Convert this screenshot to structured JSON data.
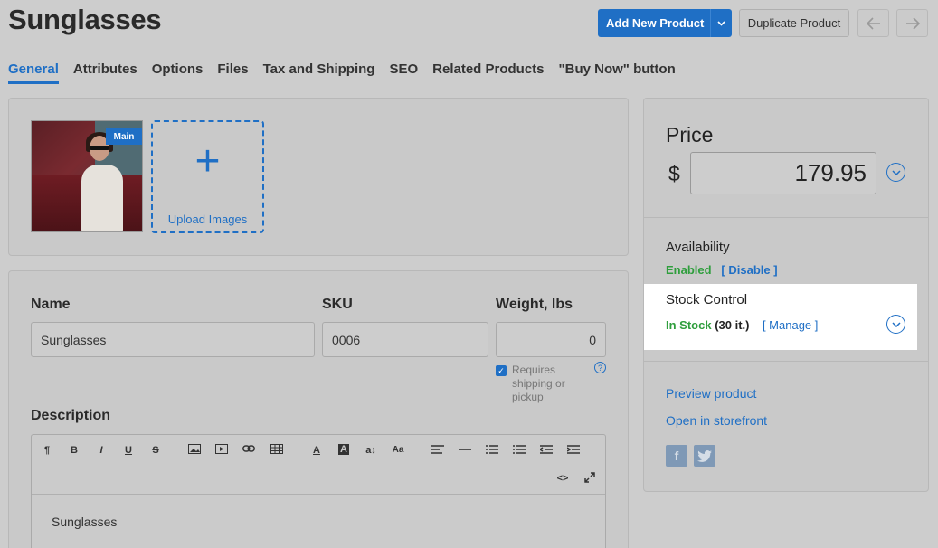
{
  "header": {
    "title": "Sunglasses",
    "add_new_label": "Add New Product",
    "duplicate_label": "Duplicate Product"
  },
  "tabs": [
    {
      "label": "General",
      "active": true
    },
    {
      "label": "Attributes"
    },
    {
      "label": "Options"
    },
    {
      "label": "Files"
    },
    {
      "label": "Tax and Shipping"
    },
    {
      "label": "SEO"
    },
    {
      "label": "Related Products"
    },
    {
      "label": "\"Buy Now\" button"
    }
  ],
  "images": {
    "main_badge": "Main",
    "upload_label": "Upload Images"
  },
  "fields": {
    "name_label": "Name",
    "name_value": "Sunglasses",
    "sku_label": "SKU",
    "sku_value": "0006",
    "weight_label": "Weight, lbs",
    "weight_value": "0",
    "shipping_label": "Requires shipping or pickup",
    "shipping_checked": true,
    "description_label": "Description",
    "description_text": "Sunglasses"
  },
  "editor_toolbar": [
    "¶",
    "B",
    "I",
    "U",
    "S",
    "image",
    "video",
    "link",
    "table",
    "A",
    "A",
    "a↕",
    "Aa",
    "align",
    "hr",
    "ul",
    "ol",
    "outdent",
    "indent",
    "<>",
    "fullscreen"
  ],
  "price": {
    "title": "Price",
    "currency": "$",
    "value": "179.95"
  },
  "availability": {
    "title": "Availability",
    "status": "Enabled",
    "action": "[ Disable ]"
  },
  "stock": {
    "title": "Stock Control",
    "status": "In Stock",
    "count": "(30 it.)",
    "action": "[ Manage ]"
  },
  "links": {
    "preview": "Preview product",
    "storefront": "Open in storefront"
  },
  "colors": {
    "accent": "#1f6fc5",
    "success": "#2f9e3d"
  }
}
